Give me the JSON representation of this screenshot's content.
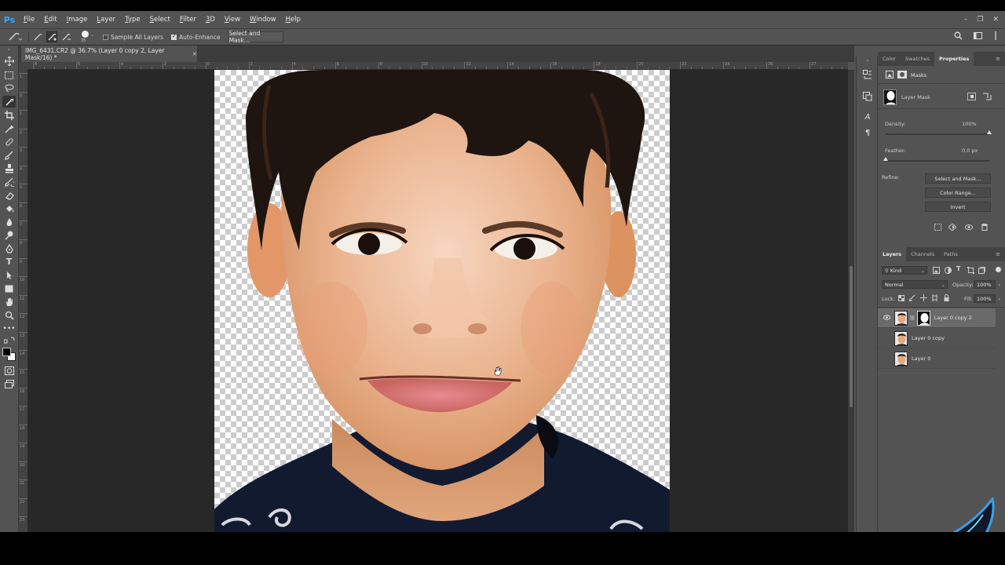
{
  "app": {
    "logo": "Ps",
    "menu": [
      {
        "label": "File",
        "hot": "F",
        "rest": "ile"
      },
      {
        "label": "Edit",
        "hot": "E",
        "rest": "dit"
      },
      {
        "label": "Image",
        "hot": "I",
        "rest": "mage"
      },
      {
        "label": "Layer",
        "hot": "L",
        "rest": "ayer"
      },
      {
        "label": "Type",
        "hot": "T",
        "rest": "ype"
      },
      {
        "label": "Select",
        "hot": "S",
        "rest": "elect"
      },
      {
        "label": "Filter",
        "hot": "F",
        "rest": "ilter"
      },
      {
        "label": "3D",
        "hot": "3",
        "rest": "D"
      },
      {
        "label": "View",
        "hot": "V",
        "rest": "iew"
      },
      {
        "label": "Window",
        "hot": "W",
        "rest": "indow"
      },
      {
        "label": "Help",
        "hot": "H",
        "rest": "elp"
      }
    ],
    "window_controls": {
      "minimize": "–",
      "restore": "❐",
      "close": "✕"
    }
  },
  "options_bar": {
    "brush_size": "35",
    "sample_all_layers": {
      "label": "Sample All Layers",
      "checked": false
    },
    "auto_enhance": {
      "label": "Auto-Enhance",
      "checked": true
    },
    "select_and_mask": "Select and Mask..."
  },
  "document": {
    "tab_title": "IMG_6431.CR2 @ 36.7% (Layer 0 copy 2, Layer Mask/16) *",
    "close": "×",
    "ruler_top": [
      "8",
      "6",
      "4",
      "2",
      "0",
      "2",
      "4",
      "6",
      "8",
      "10",
      "12",
      "14",
      "16",
      "18",
      "20",
      "22",
      "24",
      "26",
      "27"
    ],
    "ruler_left": [
      "1",
      "0",
      "1",
      "2",
      "3",
      "4",
      "5",
      "6",
      "7",
      "8",
      "9",
      "10",
      "11",
      "12",
      "13",
      "14",
      "15",
      "16",
      "17",
      "18",
      "19",
      "20",
      "21",
      "22",
      "23"
    ]
  },
  "properties_panel": {
    "tabs": [
      "Color",
      "Swatches",
      "Properties"
    ],
    "active_tab": "Properties",
    "section": "Masks",
    "mask_label": "Layer Mask",
    "density_label": "Density:",
    "density_value": "100%",
    "density_fraction": 1.0,
    "feather_label": "Feather:",
    "feather_value": "0.0 px",
    "feather_fraction": 0.0,
    "refine_label": "Refine:",
    "buttons": [
      "Select and Mask...",
      "Color Range...",
      "Invert"
    ]
  },
  "layers_panel": {
    "tabs": [
      "Layers",
      "Channels",
      "Paths"
    ],
    "active_tab": "Layers",
    "filter_kind": "Kind",
    "blend_mode": "Normal",
    "opacity_label": "Opacity:",
    "opacity_value": "100%",
    "lock_label": "Lock:",
    "fill_label": "Fill:",
    "fill_value": "100%",
    "layers": [
      {
        "name": "Layer 0 copy 2",
        "visible": true,
        "selected": true,
        "has_mask": true
      },
      {
        "name": "Layer 0 copy",
        "visible": false,
        "selected": false,
        "has_mask": false
      },
      {
        "name": "Layer 0",
        "visible": false,
        "selected": false,
        "has_mask": false
      }
    ]
  },
  "colors": {
    "ui_bg": "#535353",
    "canvas_bg": "#282828",
    "accent": "#31a8ff"
  }
}
